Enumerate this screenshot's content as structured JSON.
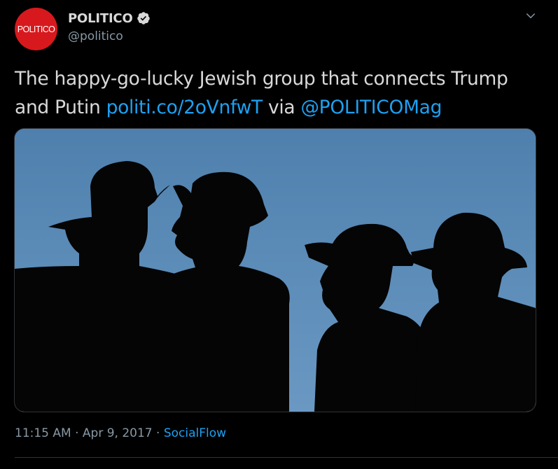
{
  "account": {
    "avatar_text": "POLITICO",
    "display_name": "POLITICO",
    "handle": "@politico",
    "verified_icon": "verified-badge-icon",
    "brand_color": "#d7191d"
  },
  "tweet": {
    "text_before": "The happy-go-lucky Jewish group that connects Trump and Putin ",
    "link": "politi.co/2oVnfwT",
    "text_mid": " via ",
    "mention": "@POLITICOMag",
    "link_color": "#1da1f2"
  },
  "media": {
    "icon": "photo-icon",
    "sky_color": "#5a8ab6"
  },
  "meta": {
    "time": "11:15 AM",
    "separator": " · ",
    "date": "Apr 9, 2017",
    "source": "SocialFlow"
  },
  "menu": {
    "icon": "chevron-down-icon"
  }
}
